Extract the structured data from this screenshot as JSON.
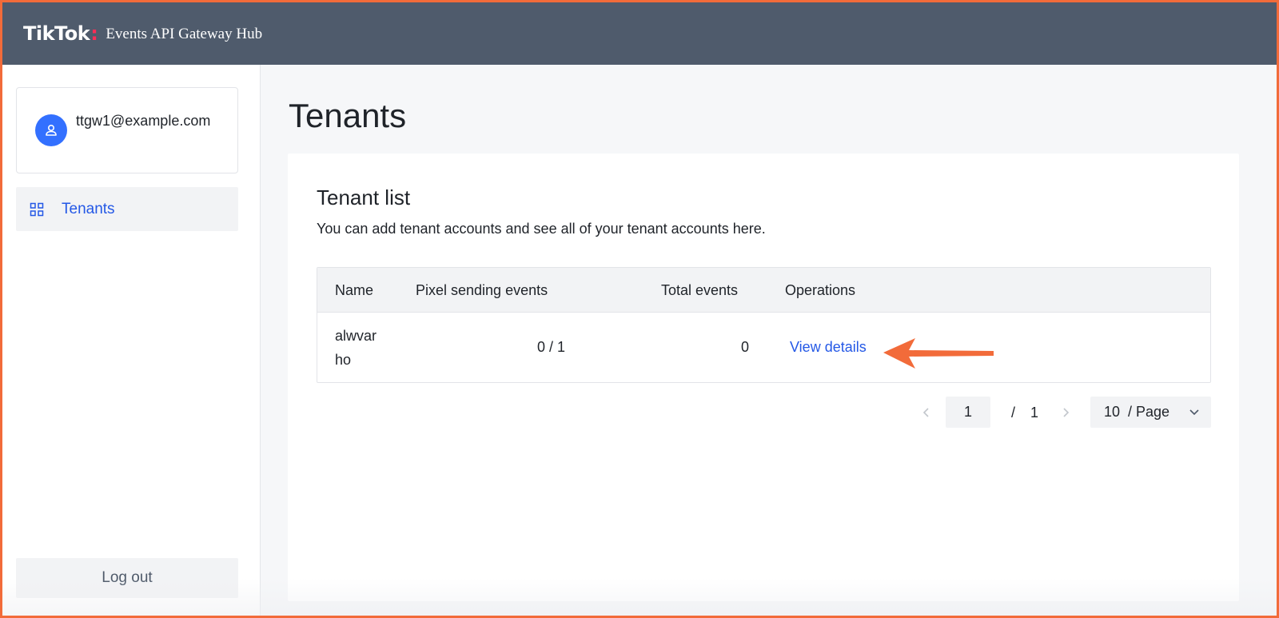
{
  "header": {
    "logo_text": "TikTok",
    "logo_dot": ":",
    "app_title": "Events API Gateway Hub"
  },
  "sidebar": {
    "user_email": "ttgw1@example.com",
    "user_icon": "user-icon",
    "items": [
      {
        "label": "Tenants",
        "icon": "grid-icon",
        "active": true
      }
    ],
    "logout_label": "Log out"
  },
  "main": {
    "page_title": "Tenants",
    "section_title": "Tenant list",
    "section_description": "You can add tenant accounts and see all of your tenant accounts here.",
    "table": {
      "columns": [
        "Name",
        "Pixel sending events",
        "Total events",
        "Operations"
      ],
      "rows": [
        {
          "name": "alwvarho",
          "pixel_sending_events": "0 / 1",
          "total_events": "0",
          "operation": "View details"
        }
      ]
    },
    "pagination": {
      "current_page": "1",
      "separator": "/",
      "total_pages": "1",
      "page_size_value": "10",
      "page_size_suffix": "/ Page"
    }
  },
  "colors": {
    "header_bg": "#4f5b6c",
    "accent": "#2458e6",
    "avatar_bg": "#3370ff",
    "annotation_arrow": "#f26b3a",
    "frame_border": "#f26b3a"
  }
}
